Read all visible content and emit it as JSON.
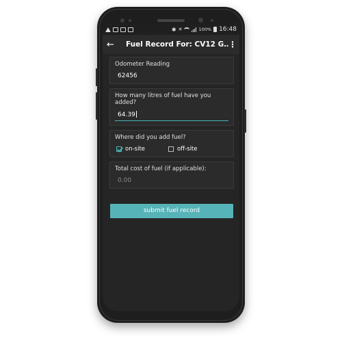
{
  "statusbar": {
    "left_icons": [
      "alert-icon",
      "sim-icon",
      "image-icon",
      "mail-icon"
    ],
    "right_icons": [
      "bluetooth-icon",
      "mute-icon",
      "wifi-icon",
      "signal-icon"
    ],
    "battery_text": "100%",
    "time": "16:48"
  },
  "appbar": {
    "back_icon": "←",
    "title": "Fuel Record For: CV12 G…",
    "menu_icon": "⋮"
  },
  "odometer": {
    "label": "Odometer Reading",
    "value": "62456"
  },
  "litres": {
    "label": "How many litres of fuel have you added?",
    "value": "64.39"
  },
  "location": {
    "label": "Where did you add fuel?",
    "options": [
      {
        "label": "on-site",
        "checked": true
      },
      {
        "label": "off-site",
        "checked": false
      }
    ]
  },
  "cost": {
    "label": "Total cost of fuel (if applicable):",
    "placeholder": "0.00"
  },
  "submit": {
    "label": "submit fuel record"
  },
  "colors": {
    "accent": "#56b3b8",
    "background": "#252525",
    "card": "#2b2b2b"
  }
}
